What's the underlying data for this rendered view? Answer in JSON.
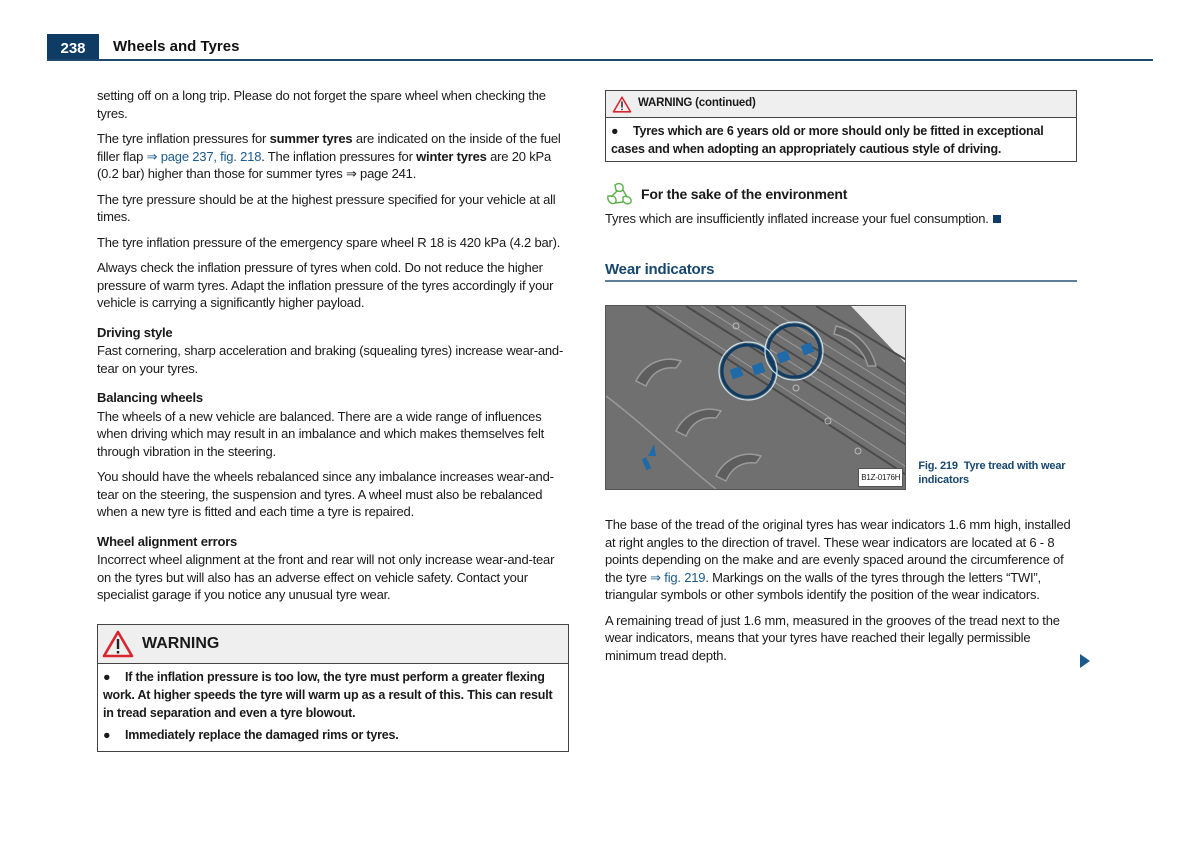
{
  "header": {
    "page_number": "238",
    "chapter_title": "Wheels and Tyres"
  },
  "left_column": {
    "p1": "setting off on a long trip. Please do not forget the spare wheel when checking the tyres.",
    "p2": {
      "t1": "The tyre inflation pressures for ",
      "b1": "summer tyres",
      "t2": " are indicated on the inside of the fuel filler flap ",
      "link1": "⇒ page 237, fig. 218",
      "t3": ". The inflation pressures for ",
      "b2": "winter tyres",
      "t4": " are 20 kPa (0.2 bar) higher than those for summer tyres ",
      "link2": "⇒ page 241",
      "t5": "."
    },
    "p3": "The tyre pressure should be at the highest pressure specified for your vehicle at all times.",
    "p4": "The tyre inflation pressure of the emergency spare wheel R 18 is 420 kPa (4.2 bar).",
    "p5": "Always check the inflation pressure of tyres when cold. Do not reduce the higher pressure of warm tyres. Adapt the inflation pressure of the tyres accordingly if your vehicle is carrying a significantly higher payload.",
    "driving_style": {
      "heading": "Driving style",
      "text": "Fast cornering, sharp acceleration and braking (squealing tyres) increase wear-and-tear on your tyres."
    },
    "balancing": {
      "heading": "Balancing wheels",
      "p1": "The wheels of a new vehicle are balanced. There are a wide range of influences when driving which may result in an imbalance and which makes themselves felt through vibration in the steering.",
      "p2": "You should have the wheels rebalanced since any imbalance increases wear-and-tear on the steering, the suspension and tyres. A wheel must also be rebalanced when a new tyre is fitted and each time a tyre is repaired."
    },
    "alignment": {
      "heading": "Wheel alignment errors",
      "text": "Incorrect wheel alignment at the front and rear will not only increase wear-and-tear on the tyres but will also has an adverse effect on vehicle safety. Contact your specialist garage if you notice any unusual tyre wear."
    },
    "warning": {
      "title": "WARNING",
      "items": [
        "If the inflation pressure is too low, the tyre must perform a greater flexing work. At higher speeds the tyre will warm up as a result of this. This can result in tread separation and even a tyre blowout.",
        "Immediately replace the damaged rims or tyres."
      ]
    }
  },
  "right_column": {
    "warning_continued": {
      "title": "WARNING (continued)",
      "items": [
        "Tyres which are 6 years old or more should only be fitted in exceptional cases and when adopting an appropriately cautious style of driving."
      ]
    },
    "environment": {
      "title": "For the sake of the environment",
      "text": "Tyres which are insufficiently inflated increase your fuel consumption."
    },
    "wear_indicators": {
      "heading": "Wear indicators",
      "figure": {
        "code": "B1Z-0176H",
        "caption_number": "Fig. 219",
        "caption_text": "Tyre tread with wear indicators"
      },
      "p1": {
        "t1": "The base of the tread of the original tyres has wear indicators 1.6 mm high, installed at right angles to the direction of travel. These wear indicators are located at 6 - 8 points depending on the make and are evenly spaced around the circumference of the tyre ",
        "link": "⇒ fig. 219",
        "t2": ". Markings on the walls of the tyres through the letters “TWI”, triangular symbols or other symbols identify the position of the wear indicators."
      },
      "p2": "A remaining tread of just 1.6 mm, measured in the grooves of the tread next to the wear indicators, means that your tyres have reached their legally permissible minimum tread depth."
    }
  },
  "colors": {
    "brand_blue": "#0e3c64",
    "link_blue": "#1d5a8c",
    "warning_red": "#d9262e",
    "environment_green": "#5bb04a"
  }
}
